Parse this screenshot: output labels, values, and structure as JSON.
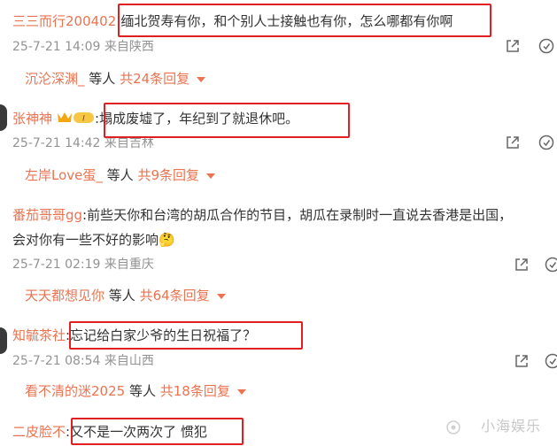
{
  "comments": [
    {
      "author": "三三而行200402",
      "text": ":缅北贺寿有你，和个别人士接触也有你，怎么哪都有你啊",
      "time": "25-7-21 14:09",
      "location": "来自陕西",
      "reply_author": "沉沦深渊_",
      "reply_mid": "等人",
      "reply_count": "共24条回复"
    },
    {
      "author": "张神神",
      "badge_text": "I",
      "text": ":塌成废墟了，年纪到了就退休吧。",
      "time": "25-7-21 14:42",
      "location": "来自吉林",
      "reply_author": "左岸Love蛋_",
      "reply_mid": "等人",
      "reply_count": "共9条回复"
    },
    {
      "author": "番茄哥哥gg",
      "text": ":前些天你和台湾的胡瓜合作的节目，胡瓜在录制时一直说去香港是出国，",
      "text2": "会对你有一些不好的影响",
      "emoji": "🤔",
      "time": "25-7-21 02:19",
      "location": "来自重庆",
      "reply_author": "天天都想见你",
      "reply_mid": "等人",
      "reply_count": "共64条回复"
    },
    {
      "author": "知毓茶社",
      "text": ":忘记给白家少爷的生日祝福了？",
      "time": "25-7-21 08:54",
      "location": "来自山西",
      "reply_author": "看不清的迷2025",
      "reply_mid": "等人",
      "reply_count": "共18条回复"
    },
    {
      "author": "二皮脸不",
      "text": ":又不是一次两次了 惯犯"
    }
  ],
  "watermark": "小海娱乐",
  "colors": {
    "accent": "#eb7350",
    "highlight_box": "#e02020",
    "meta": "#939393"
  },
  "icons": [
    "share-icon",
    "more-icon",
    "vip-badge-icon",
    "watermark-icon"
  ]
}
